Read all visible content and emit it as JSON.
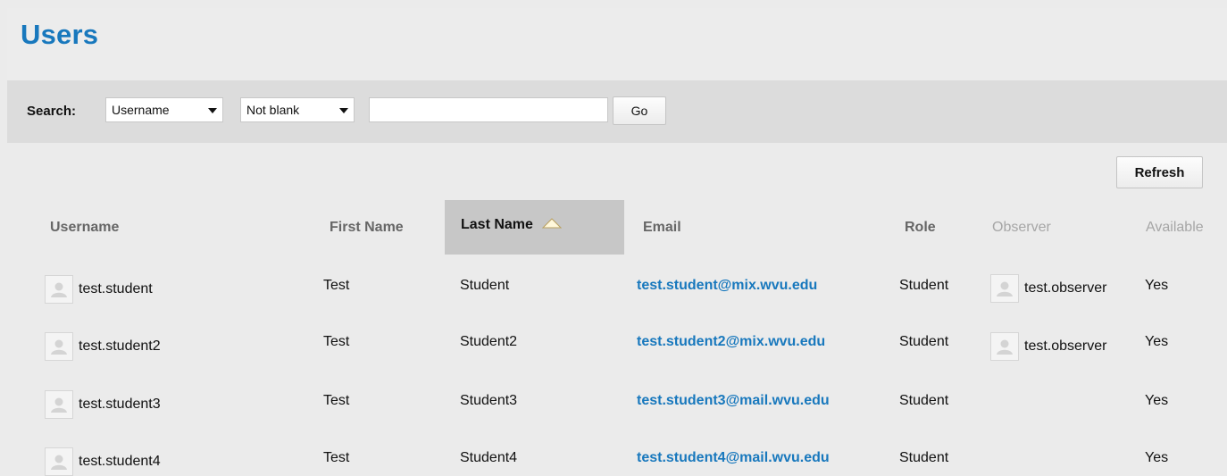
{
  "page": {
    "title": "Users"
  },
  "search": {
    "label": "Search:",
    "field_selected": "Username",
    "operator_selected": "Not blank",
    "value": "",
    "go_label": "Go"
  },
  "toolbar": {
    "refresh_label": "Refresh"
  },
  "table": {
    "columns": {
      "username": "Username",
      "first_name": "First Name",
      "last_name": "Last Name",
      "email": "Email",
      "role": "Role",
      "observer": "Observer",
      "available": "Available"
    },
    "sort": {
      "column": "Last Name",
      "direction": "ascending"
    },
    "rows": [
      {
        "username": "test.student",
        "first_name": "Test",
        "last_name": "Student",
        "email": "test.student@mix.wvu.edu",
        "role": "Student",
        "observer": "test.observer",
        "available": "Yes"
      },
      {
        "username": "test.student2",
        "first_name": "Test",
        "last_name": "Student2",
        "email": "test.student2@mix.wvu.edu",
        "role": "Student",
        "observer": "test.observer",
        "available": "Yes"
      },
      {
        "username": "test.student3",
        "first_name": "Test",
        "last_name": "Student3",
        "email": "test.student3@mail.wvu.edu",
        "role": "Student",
        "observer": "",
        "available": "Yes"
      },
      {
        "username": "test.student4",
        "first_name": "Test",
        "last_name": "Student4",
        "email": "test.student4@mail.wvu.edu",
        "role": "Student",
        "observer": "",
        "available": "Yes"
      }
    ]
  },
  "icons": {
    "avatar": "user-avatar-icon",
    "dropdown": "chevron-down-icon",
    "sort": "sort-ascending-icon"
  },
  "colors": {
    "title": "#1878bd",
    "link": "#1878bd",
    "sorted_header_bg": "#c7c7c7"
  }
}
